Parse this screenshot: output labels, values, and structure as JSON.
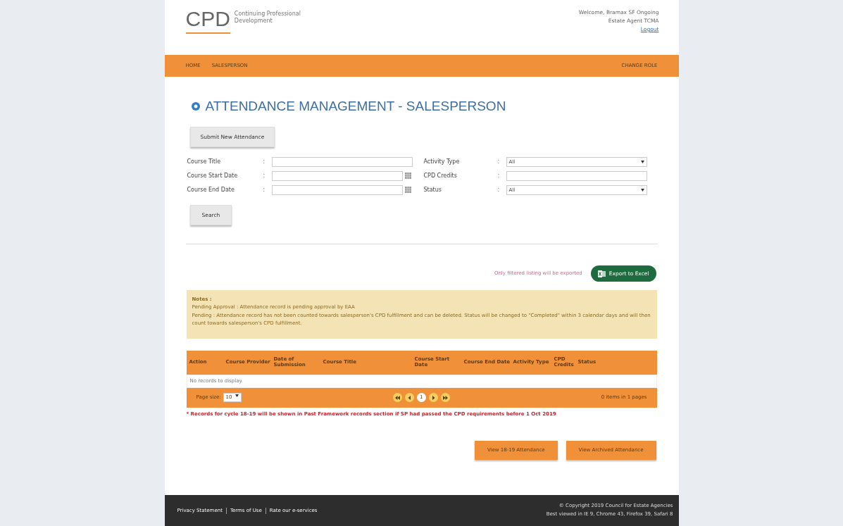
{
  "header": {
    "logo_letters": "CPD",
    "logo_subtitle": [
      "Continuing Professional",
      "Development"
    ],
    "welcome": "Welcome, Bramax SF Ongoing",
    "role": "Estate Agent TCMA",
    "logout": "Logout"
  },
  "nav": {
    "items": [
      {
        "label": "HOME"
      },
      {
        "label": "SALESPERSON"
      }
    ],
    "right": "CHANGE ROLE"
  },
  "page_title": "ATTENDANCE MANAGEMENT - SALESPERSON",
  "submit_button": "Submit New Attendance",
  "filters": [
    {
      "label": "Course Title",
      "kind": "text"
    },
    {
      "label": "Activity Type",
      "kind": "select",
      "value": "All"
    },
    {
      "label": "Course Start Date",
      "kind": "date"
    },
    {
      "label": "CPD Credits",
      "kind": "text"
    },
    {
      "label": "Course End Date",
      "kind": "date"
    },
    {
      "label": "Status",
      "kind": "select",
      "value": "All"
    }
  ],
  "separator": ":",
  "search_button": "Search",
  "export": {
    "note": "Only filtered listing will be exported",
    "button": "Export to Excel"
  },
  "notes": {
    "title": "Notes :",
    "lines": [
      "Pending Approval : Attendance record is pending approval by EAA",
      "Pending : Attendance record has not been counted towards salesperson's CPD fulfillment and can be deleted. Status will be changed to \"Completed\" within 3 calendar days and will then count towards salesperson's CPD fulfillment."
    ]
  },
  "table": {
    "columns": [
      "Action",
      "Course Provider",
      "Date of Submission",
      "Course Title",
      "Course Start Date",
      "Course End Date",
      "Activity Type",
      "CPD Credits",
      "Status"
    ],
    "empty": "No records to display."
  },
  "pager": {
    "page_size_label": "Page size:",
    "page_size": "10",
    "pages": [
      {
        "label": "1",
        "selected": true
      }
    ],
    "summary": "0 items in 1 pages"
  },
  "footnote": "* Records for cycle 18-19 will be shown in Past Framework records section if SP had passed the CPD requirements before 1 Oct 2019",
  "bottom_buttons": [
    "View 18-19 Attendance",
    "View Archived Attendance"
  ],
  "footer": {
    "links": [
      "Privacy Statement",
      "Terms of Use",
      "Rate our e-services"
    ],
    "copyright": "© Copyright 2019 Council for Estate Agencies",
    "browsers": "Best viewed in IE 9, Chrome 43, Firefox 39, Safari 8"
  }
}
